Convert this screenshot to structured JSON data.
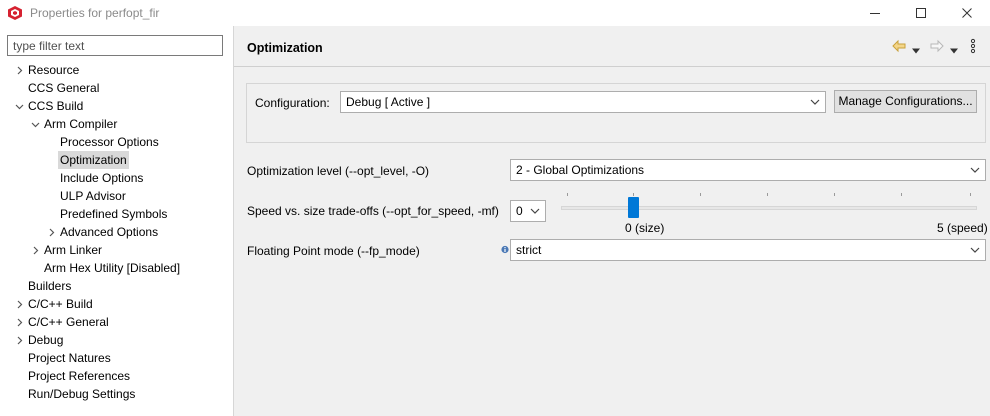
{
  "window": {
    "title": "Properties for perfopt_fir",
    "colors": {
      "title_text": "#8a8a8a",
      "accent": "#0078d7",
      "tree_selected": "#d9d9d9",
      "app_icon": "#d62231"
    }
  },
  "filter": {
    "placeholder": "type filter text"
  },
  "tree": {
    "items": [
      {
        "label": "Resource",
        "twisty": "collapsed"
      },
      {
        "label": "CCS General",
        "twisty": "none"
      },
      {
        "label": "CCS Build",
        "twisty": "expanded"
      },
      {
        "label": "Arm Compiler",
        "twisty": "expanded"
      },
      {
        "label": "Processor Options",
        "twisty": "none"
      },
      {
        "label": "Optimization",
        "twisty": "none",
        "selected": true
      },
      {
        "label": "Include Options",
        "twisty": "none"
      },
      {
        "label": "ULP Advisor",
        "twisty": "none"
      },
      {
        "label": "Predefined Symbols",
        "twisty": "none"
      },
      {
        "label": "Advanced Options",
        "twisty": "collapsed"
      },
      {
        "label": "Arm Linker",
        "twisty": "collapsed"
      },
      {
        "label": "Arm Hex Utility  [Disabled]",
        "twisty": "none"
      },
      {
        "label": "Builders",
        "twisty": "none"
      },
      {
        "label": "C/C++ Build",
        "twisty": "collapsed"
      },
      {
        "label": "C/C++ General",
        "twisty": "collapsed"
      },
      {
        "label": "Debug",
        "twisty": "collapsed"
      },
      {
        "label": "Project Natures",
        "twisty": "none"
      },
      {
        "label": "Project References",
        "twisty": "none"
      },
      {
        "label": "Run/Debug Settings",
        "twisty": "none"
      }
    ]
  },
  "page": {
    "title": "Optimization",
    "configuration": {
      "label": "Configuration:",
      "value": "Debug  [ Active ]",
      "manage_button": "Manage Configurations..."
    },
    "opt_level": {
      "label": "Optimization level (--opt_level, -O)",
      "value": "2 - Global Optimizations"
    },
    "speed_size": {
      "label": "Speed vs. size trade-offs (--opt_for_speed, -mf)",
      "value": "0",
      "min_label": "0 (size)",
      "max_label": "5 (speed)",
      "slider_value": 0,
      "slider_max": 5
    },
    "fp_mode": {
      "label": "Floating Point mode (--fp_mode)",
      "value": "strict"
    }
  }
}
